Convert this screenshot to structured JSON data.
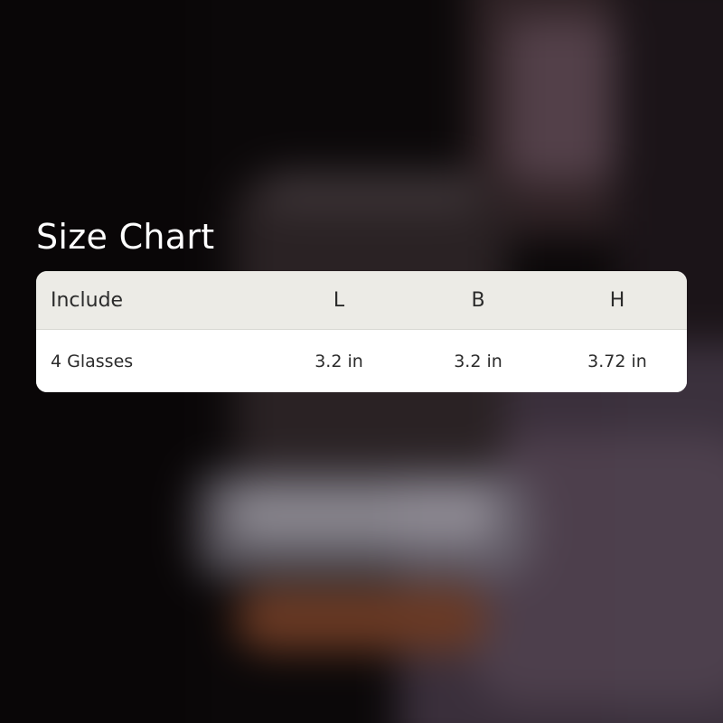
{
  "title": "Size Chart",
  "table": {
    "headers": [
      "Include",
      "L",
      "B",
      "H"
    ],
    "rows": [
      [
        "4 Glasses",
        "3.2 in",
        "3.2 in",
        "3.72 in"
      ]
    ]
  },
  "colors": {
    "header_bg": "#ecebe6",
    "row_bg": "#ffffff",
    "text": "#2b2b2b",
    "title": "#ffffff"
  }
}
